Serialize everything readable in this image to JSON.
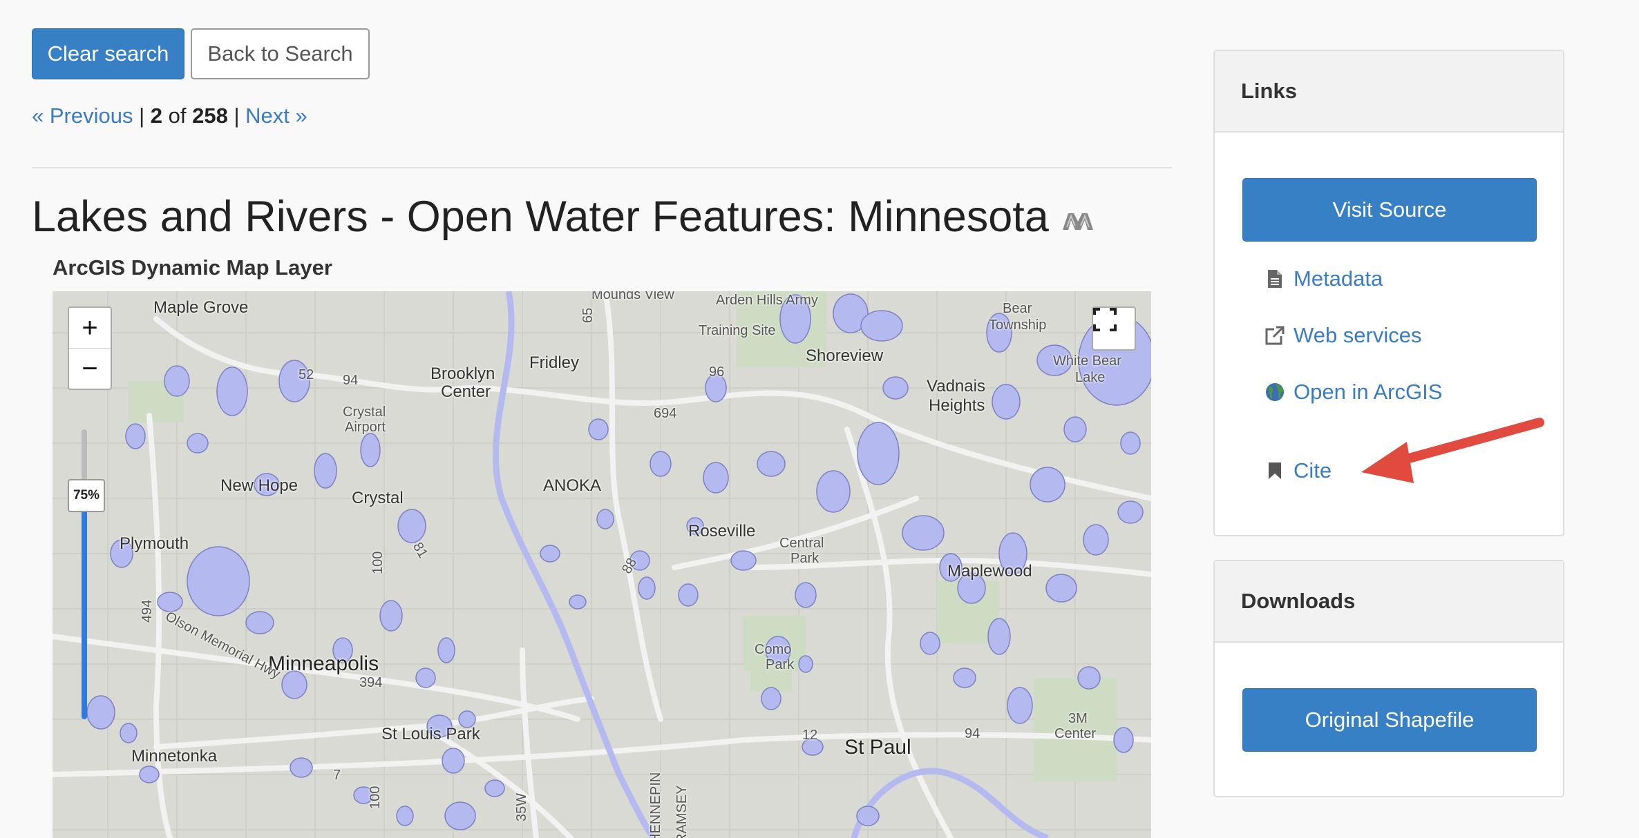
{
  "toolbar": {
    "clear_search": "Clear search",
    "back_to_search": "Back to Search"
  },
  "pager": {
    "previous": "« Previous",
    "current": "2",
    "of": "of",
    "total": "258",
    "next": "Next »"
  },
  "record": {
    "title": "Lakes and Rivers - Open Water Features: Minnesota",
    "title_icon": "university-logo-icon",
    "layer_type": "ArcGIS Dynamic Map Layer"
  },
  "map": {
    "zoom_in": "+",
    "zoom_out": "−",
    "opacity": 0.75,
    "opacity_label": "75%",
    "labels": {
      "maple_grove": "Maple Grove",
      "mounds_view": "Mounds View",
      "arden_hills_army": "Arden Hills Army",
      "training_site": "Training Site",
      "bear_township_1": "Bear",
      "bear_township_2": "Township",
      "white_bear_lake_1": "White Bear",
      "white_bear_lake_2": "Lake",
      "brooklyn_center_1": "Brooklyn",
      "brooklyn_center_2": "Center",
      "fridley": "Fridley",
      "shoreview": "Shoreview",
      "vadnais_1": "Vadnais",
      "vadnais_2": "Heights",
      "crystal_airport_1": "Crystal",
      "crystal_airport_2": "Airport",
      "new_hope": "New Hope",
      "crystal": "Crystal",
      "anoka": "ANOKA",
      "roseville": "Roseville",
      "central_park_1": "Central",
      "central_park_2": "Park",
      "maplewood": "Maplewood",
      "plymouth": "Plymouth",
      "olson_hwy": "Olson Memorial Hwy",
      "minneapolis": "Minneapolis",
      "como_park_1": "Como",
      "como_park_2": "Park",
      "st_louis_park": "St Louis Park",
      "st_paul": "St Paul",
      "minnetonka": "Minnetonka",
      "center_3m_1": "3M",
      "center_3m_2": "Center",
      "r52": "52",
      "r94a": "94",
      "r96": "96",
      "r694": "694",
      "r394": "394",
      "r494": "494",
      "r100a": "100",
      "r100b": "100",
      "r81": "81",
      "r88": "88",
      "r12": "12",
      "r94b": "94",
      "r35w": "35W",
      "r7": "7",
      "r65": "65",
      "hennepin": "HENNEPIN",
      "ramsey": "RAMSEY"
    }
  },
  "links_panel": {
    "heading": "Links",
    "visit_source": "Visit Source",
    "metadata": "Metadata",
    "web_services": "Web services",
    "open_in_arcgis": "Open in ArcGIS",
    "cite": "Cite"
  },
  "downloads_panel": {
    "heading": "Downloads",
    "original_shapefile": "Original Shapefile"
  },
  "colors": {
    "primary": "#3780c5",
    "link": "#3a7cc1",
    "water": "#b4b9f0",
    "arrow": "#e04a3f"
  }
}
